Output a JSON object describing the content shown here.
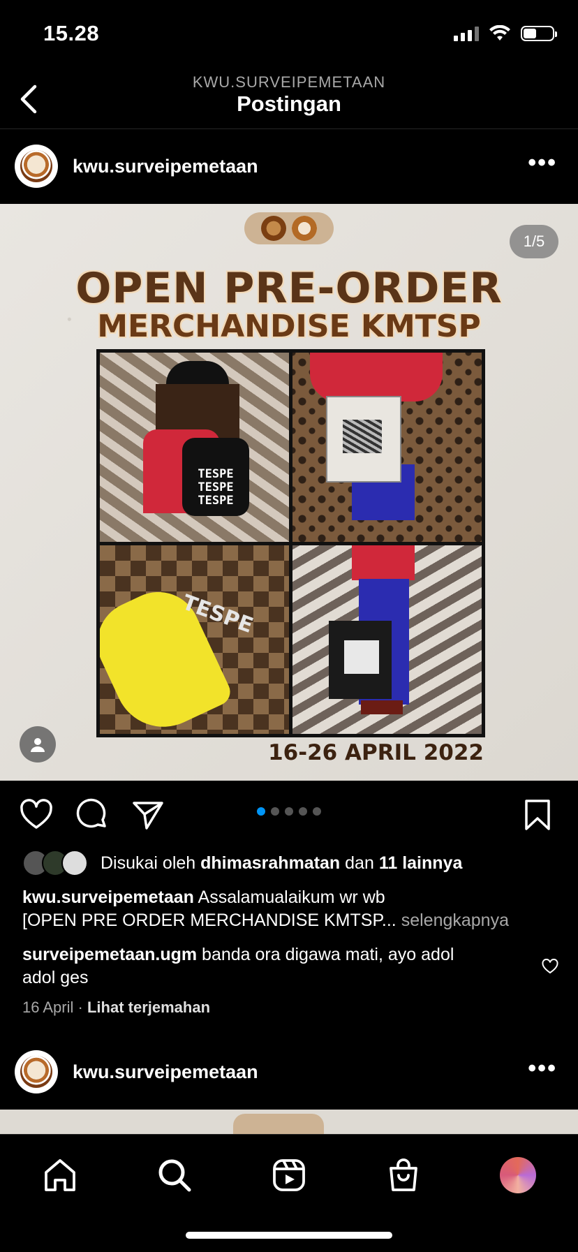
{
  "status_bar": {
    "time": "15.28"
  },
  "header": {
    "account": "KWU.SURVEIPEMETAAN",
    "title": "Postingan"
  },
  "post": {
    "username": "kwu.surveipemetaan",
    "image": {
      "counter": "1/5",
      "headline": "OPEN PRE-ORDER",
      "subheadline": "MERCHANDISE KMTSP",
      "date": "16-26 APRIL 2022",
      "print_word": "TESPE"
    },
    "carousel": {
      "total": 5,
      "active": 1
    },
    "likes": {
      "prefix": "Disukai oleh",
      "user": "dhimasrahmatan",
      "middle": "dan",
      "others": "11 lainnya"
    },
    "caption": {
      "username": "kwu.surveipemetaan",
      "line1": "Assalamualaikum wr wb",
      "line2": "[OPEN PRE ORDER MERCHANDISE KMTSP...",
      "more": "selengkapnya"
    },
    "comment": {
      "username": "surveipemetaan.ugm",
      "text_line1": "banda ora digawa mati, ayo adol",
      "text_line2": "adol ges"
    },
    "date": "16 April",
    "translate": "Lihat terjemahan"
  },
  "next_post": {
    "username": "kwu.surveipemetaan"
  },
  "colors": {
    "accent": "#0095f6",
    "background": "#000000",
    "muted": "#a8a8a8"
  },
  "tabs": [
    "home-icon",
    "search-icon",
    "reels-icon",
    "shop-icon",
    "profile-avatar"
  ]
}
